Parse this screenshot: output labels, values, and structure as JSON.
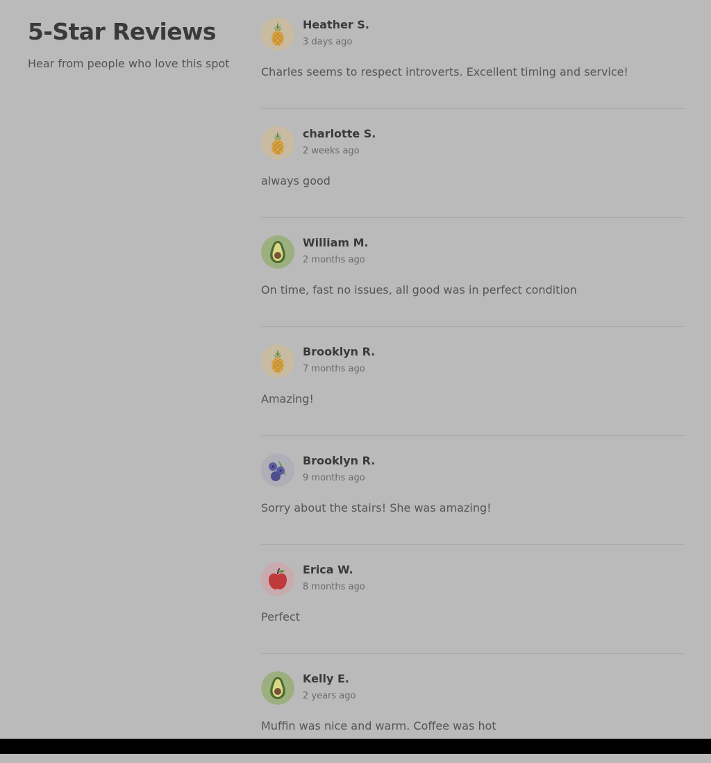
{
  "header": {
    "title": "5-Star Reviews",
    "subtitle": "Hear from people who love this spot"
  },
  "reviews": [
    {
      "name": "Heather S.",
      "time": "3 days ago",
      "text": "Charles seems to respect introverts. Excellent timing and service!",
      "avatar": "pineapple-icon"
    },
    {
      "name": "charlotte S.",
      "time": "2 weeks ago",
      "text": "always good",
      "avatar": "pineapple-icon"
    },
    {
      "name": "William M.",
      "time": "2 months ago",
      "text": "On time, fast no issues, all good was in perfect condition",
      "avatar": "avocado-icon"
    },
    {
      "name": "Brooklyn R.",
      "time": "7 months ago",
      "text": "Amazing!",
      "avatar": "pineapple-icon"
    },
    {
      "name": "Brooklyn R.",
      "time": "9 months ago",
      "text": "Sorry about the stairs! She was amazing!",
      "avatar": "blueberry-icon"
    },
    {
      "name": "Erica W.",
      "time": "8 months ago",
      "text": "Perfect",
      "avatar": "apple-icon"
    },
    {
      "name": "Kelly E.",
      "time": "2 years ago",
      "text": "Muffin was nice and warm. Coffee was hot",
      "avatar": "avocado-icon"
    }
  ]
}
